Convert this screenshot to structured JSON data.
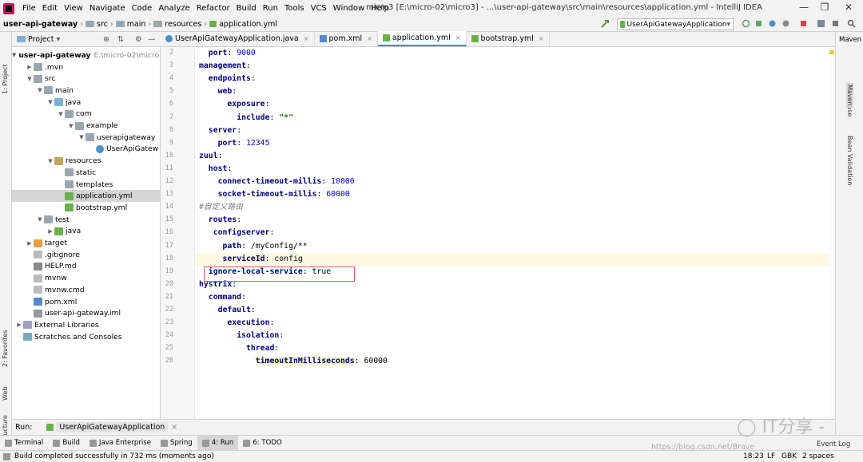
{
  "menubar": {
    "items": [
      "File",
      "Edit",
      "View",
      "Navigate",
      "Code",
      "Analyze",
      "Refactor",
      "Build",
      "Run",
      "Tools",
      "VCS",
      "Window",
      "Help"
    ],
    "title": "micro3 [E:\\micro-02\\micro3] - ...\\user-api-gateway\\src\\main\\resources\\application.yml - IntelliJ IDEA"
  },
  "breadcrumb": [
    "user-api-gateway",
    "src",
    "main",
    "resources",
    "application.yml"
  ],
  "run_config": "UserApiGatewayApplication",
  "project_panel": {
    "title": "Project",
    "tree": [
      {
        "label": "user-api-gateway",
        "extra": "E:\\micro-02\\micro3",
        "depth": 0,
        "open": true,
        "icon": "module"
      },
      {
        "label": ".mvn",
        "depth": 1,
        "open": false,
        "icon": "folder"
      },
      {
        "label": "src",
        "depth": 1,
        "open": true,
        "icon": "folder"
      },
      {
        "label": "main",
        "depth": 2,
        "open": true,
        "icon": "folder"
      },
      {
        "label": "java",
        "depth": 3,
        "open": true,
        "icon": "src"
      },
      {
        "label": "com",
        "depth": 4,
        "open": true,
        "icon": "pkg"
      },
      {
        "label": "example",
        "depth": 5,
        "open": true,
        "icon": "pkg"
      },
      {
        "label": "userapigateway",
        "depth": 6,
        "open": true,
        "icon": "pkg"
      },
      {
        "label": "UserApiGatew",
        "depth": 7,
        "leaf": true,
        "icon": "class"
      },
      {
        "label": "resources",
        "depth": 3,
        "open": true,
        "icon": "res"
      },
      {
        "label": "static",
        "depth": 4,
        "leaf": true,
        "icon": "folder"
      },
      {
        "label": "templates",
        "depth": 4,
        "leaf": true,
        "icon": "folder"
      },
      {
        "label": "application.yml",
        "depth": 4,
        "leaf": true,
        "icon": "yml",
        "selected": true
      },
      {
        "label": "bootstrap.yml",
        "depth": 4,
        "leaf": true,
        "icon": "yml"
      },
      {
        "label": "test",
        "depth": 2,
        "open": true,
        "icon": "folder"
      },
      {
        "label": "java",
        "depth": 3,
        "open": false,
        "icon": "test"
      },
      {
        "label": "target",
        "depth": 1,
        "open": false,
        "icon": "target"
      },
      {
        "label": ".gitignore",
        "depth": 1,
        "leaf": true,
        "icon": "file"
      },
      {
        "label": "HELP.md",
        "depth": 1,
        "leaf": true,
        "icon": "md"
      },
      {
        "label": "mvnw",
        "depth": 1,
        "leaf": true,
        "icon": "file"
      },
      {
        "label": "mvnw.cmd",
        "depth": 1,
        "leaf": true,
        "icon": "file"
      },
      {
        "label": "pom.xml",
        "depth": 1,
        "leaf": true,
        "icon": "pom"
      },
      {
        "label": "user-api-gateway.iml",
        "depth": 1,
        "leaf": true,
        "icon": "iml"
      },
      {
        "label": "External Libraries",
        "depth": 0,
        "open": false,
        "icon": "lib"
      },
      {
        "label": "Scratches and Consoles",
        "depth": 0,
        "leaf": true,
        "icon": "scratch"
      }
    ]
  },
  "tabs": [
    {
      "label": "UserApiGatewayApplication.java",
      "active": false,
      "icon": "class"
    },
    {
      "label": "pom.xml",
      "active": false,
      "icon": "pom"
    },
    {
      "label": "application.yml",
      "active": true,
      "icon": "yml"
    },
    {
      "label": "bootstrap.yml",
      "active": false,
      "icon": "yml"
    }
  ],
  "code_lines": [
    {
      "no": "2",
      "parts": [
        [
          "  ",
          "v"
        ],
        [
          "port",
          "k"
        ],
        [
          ": ",
          "v"
        ],
        [
          "9000",
          "n"
        ]
      ]
    },
    {
      "no": "3",
      "parts": [
        [
          "management",
          "k"
        ],
        [
          ":",
          "v"
        ]
      ]
    },
    {
      "no": "4",
      "parts": [
        [
          "  ",
          "v"
        ],
        [
          "endpoints",
          "k"
        ],
        [
          ":",
          "v"
        ]
      ]
    },
    {
      "no": "5",
      "parts": [
        [
          "    ",
          "v"
        ],
        [
          "web",
          "k"
        ],
        [
          ":",
          "v"
        ]
      ]
    },
    {
      "no": "6",
      "parts": [
        [
          "      ",
          "v"
        ],
        [
          "exposure",
          "k"
        ],
        [
          ":",
          "v"
        ]
      ]
    },
    {
      "no": "7",
      "parts": [
        [
          "        ",
          "v"
        ],
        [
          "include",
          "k"
        ],
        [
          ": ",
          "v"
        ],
        [
          "\"*\"",
          "s"
        ]
      ]
    },
    {
      "no": "8",
      "parts": [
        [
          "  ",
          "v"
        ],
        [
          "server",
          "k"
        ],
        [
          ":",
          "v"
        ]
      ]
    },
    {
      "no": "9",
      "parts": [
        [
          "    ",
          "v"
        ],
        [
          "port",
          "k"
        ],
        [
          ": ",
          "v"
        ],
        [
          "12345",
          "n"
        ]
      ]
    },
    {
      "no": "10",
      "parts": [
        [
          "zuul",
          "k"
        ],
        [
          ":",
          "v"
        ]
      ]
    },
    {
      "no": "11",
      "parts": [
        [
          "  ",
          "v"
        ],
        [
          "host",
          "k"
        ],
        [
          ":",
          "v"
        ]
      ]
    },
    {
      "no": "12",
      "parts": [
        [
          "    ",
          "v"
        ],
        [
          "connect-timeout-millis",
          "k"
        ],
        [
          ": ",
          "v"
        ],
        [
          "10000",
          "n"
        ]
      ]
    },
    {
      "no": "13",
      "parts": [
        [
          "    ",
          "v"
        ],
        [
          "socket-timeout-millis",
          "k"
        ],
        [
          ": ",
          "v"
        ],
        [
          "60000",
          "n"
        ]
      ]
    },
    {
      "no": "14",
      "parts": [
        [
          "#自定义路由",
          "c"
        ]
      ]
    },
    {
      "no": "15",
      "parts": [
        [
          "  ",
          "v"
        ],
        [
          "routes",
          "k"
        ],
        [
          ":",
          "v"
        ]
      ]
    },
    {
      "no": "16",
      "parts": [
        [
          "   ",
          "v"
        ],
        [
          "configserver",
          "k"
        ],
        [
          ":",
          "v"
        ]
      ]
    },
    {
      "no": "17",
      "parts": [
        [
          "     ",
          "v"
        ],
        [
          "path",
          "k"
        ],
        [
          ": /myConfig/**",
          "v"
        ]
      ]
    },
    {
      "no": "18",
      "parts": [
        [
          "     ",
          "v"
        ],
        [
          "serviceId",
          "k"
        ],
        [
          ": config",
          "v"
        ]
      ],
      "highlight": true
    },
    {
      "no": "19",
      "parts": [
        [
          "  ",
          "v"
        ],
        [
          "ignore-local-service",
          "k"
        ],
        [
          ": true",
          "v"
        ]
      ]
    },
    {
      "no": "20",
      "parts": [
        [
          "hystrix",
          "k"
        ],
        [
          ":",
          "v"
        ]
      ]
    },
    {
      "no": "21",
      "parts": [
        [
          "  ",
          "v"
        ],
        [
          "command",
          "k"
        ],
        [
          ":",
          "v"
        ]
      ]
    },
    {
      "no": "22",
      "parts": [
        [
          "    ",
          "v"
        ],
        [
          "default",
          "k"
        ],
        [
          ":",
          "v"
        ]
      ]
    },
    {
      "no": "23",
      "parts": [
        [
          "      ",
          "v"
        ],
        [
          "execution",
          "k"
        ],
        [
          ":",
          "v"
        ]
      ]
    },
    {
      "no": "24",
      "parts": [
        [
          "        ",
          "v"
        ],
        [
          "isolation",
          "k"
        ],
        [
          ":",
          "v"
        ]
      ]
    },
    {
      "no": "25",
      "parts": [
        [
          "          ",
          "v"
        ],
        [
          "thread",
          "k"
        ],
        [
          ":",
          "v"
        ]
      ]
    },
    {
      "no": "26",
      "parts": [
        [
          "            ",
          "v"
        ],
        [
          "timeoutInMilliseconds",
          "km"
        ],
        [
          ": 60000",
          "v"
        ]
      ]
    }
  ],
  "left_strip": [
    "1: Project",
    "2: Favorites",
    "Web",
    "Z: Structure"
  ],
  "right_strip": [
    "Maven",
    "Database",
    "Maven",
    "Bean Validation"
  ],
  "run_bar": {
    "label": "Run:",
    "config": "UserApiGatewayApplication"
  },
  "tool_windows": [
    {
      "label": "Terminal",
      "active": false
    },
    {
      "label": "Build",
      "active": false
    },
    {
      "label": "Java Enterprise",
      "active": false
    },
    {
      "label": "Spring",
      "active": false
    },
    {
      "label": "4: Run",
      "active": true
    },
    {
      "label": "6: TODO",
      "active": false
    }
  ],
  "event_log": "Event Log",
  "status": {
    "message": "Build completed successfully in 732 ms (moments ago)",
    "position": "18:23",
    "line_sep": "LF",
    "encoding": "GBK",
    "indent": "2 spaces"
  },
  "watermark": {
    "brand": "IT分享",
    "url": "https://blog.csdn.net/Brave"
  }
}
